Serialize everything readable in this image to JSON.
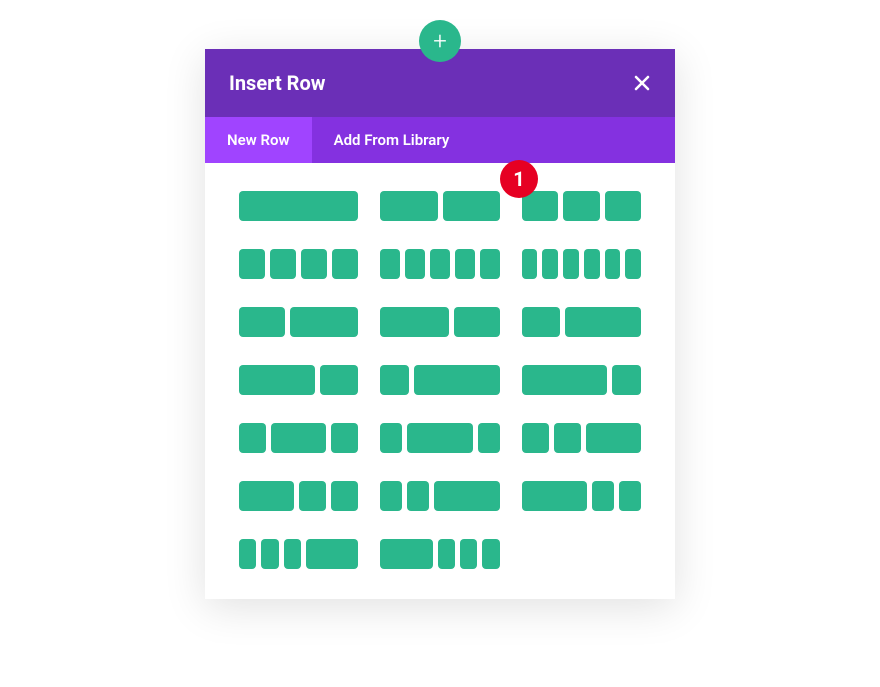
{
  "add_button_label": "+",
  "modal": {
    "title": "Insert Row",
    "close_label": "Close",
    "tabs": {
      "new_row": "New Row",
      "add_from_library": "Add From Library"
    }
  },
  "badge_value": "1",
  "layouts": {
    "row1": [
      "1",
      "1/2,1/2",
      "1/3,1/3,1/3"
    ],
    "row2": [
      "1/4,1/4,1/4,1/4",
      "1/5,1/5,1/5,1/5,1/5",
      "1/6,1/6,1/6,1/6,1/6,1/6"
    ],
    "row3": [
      "2/5,3/5",
      "3/5,2/5",
      "1/3,2/3"
    ],
    "row4": [
      "2/3,1/3",
      "1/4,3/4",
      "3/4,1/4"
    ],
    "row5": [
      "1/4,1/2,1/4",
      "1/5,3/5,1/5",
      "1/4,1/4,1/2"
    ],
    "row6": [
      "1/2,1/4,1/4",
      "1/5,1/5,3/5",
      "3/5,1/5,1/5"
    ],
    "row7": [
      "1/6,1/6,1/6,1/2",
      "1/2,1/6,1/6,1/6"
    ]
  },
  "colors": {
    "accent": "#2ab78c",
    "header": "#6b2fb7",
    "tabs_bg": "#8431e0",
    "tab_active": "#a044ff",
    "badge": "#e60023"
  }
}
